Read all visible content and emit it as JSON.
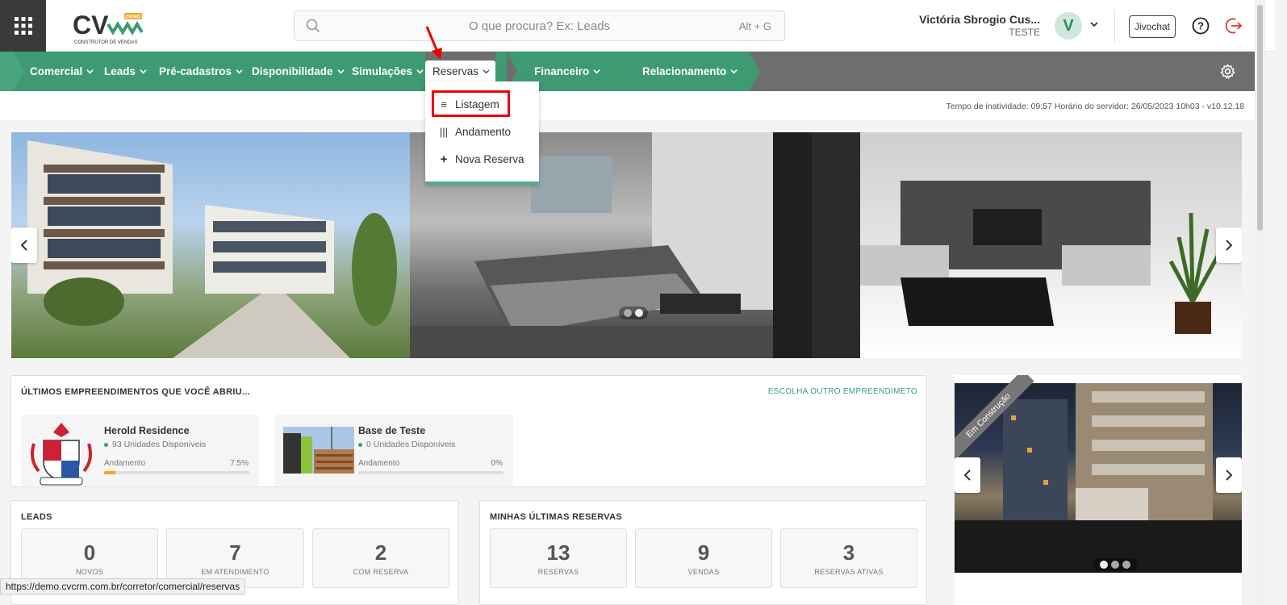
{
  "header": {
    "search": {
      "placeholder": "O que procura? Ex: Leads",
      "shortcut": "Alt + G"
    },
    "logo": {
      "text": "CV",
      "badge": "DEMO",
      "subtitle": "CONSTRUTOR DE VENDAS"
    },
    "user": {
      "name": "Victória Sbrogio Cus...",
      "role": "TESTE",
      "initial": "V"
    },
    "jivochat": "Jivochat"
  },
  "nav": {
    "items": [
      "Comercial",
      "Leads",
      "Pré-cadastros",
      "Disponibilidade",
      "Simulações",
      "Reservas",
      "Financeiro",
      "Relacionamento"
    ],
    "active": "Reservas",
    "colors": {
      "green": "#3e9a73",
      "gray": "#6e6e6e"
    }
  },
  "dropdown": {
    "items": [
      {
        "label": "Listagem",
        "icon": "list-icon"
      },
      {
        "label": "Andamento",
        "icon": "columns-icon"
      },
      {
        "label": "Nova Reserva",
        "icon": "plus-icon"
      }
    ],
    "highlighted": "Listagem"
  },
  "info": {
    "text": "Tempo de inatividade: 09:57   Horário do servidor: 26/05/2023 10h03 - v10.12.18"
  },
  "recent": {
    "title": "ÚLTIMOS EMPREENDIMENTOS QUE VOCÊ ABRIU...",
    "link": "ESCOLHA OUTRO EMPREENDIMETO",
    "items": [
      {
        "name": "Herold Residence",
        "units": "93 Unidades Disponíveis",
        "progress_label": "Andamento",
        "progress": "7.5%",
        "progress_value": 0.075
      },
      {
        "name": "Base de Teste",
        "units": "0 Unidades Disponíveis",
        "progress_label": "Andamento",
        "progress": "0%",
        "progress_value": 0
      }
    ]
  },
  "leads": {
    "title": "LEADS",
    "stats": [
      {
        "value": "0",
        "label": "NOVOS"
      },
      {
        "value": "7",
        "label": "EM ATENDIMENTO"
      },
      {
        "value": "2",
        "label": "COM RESERVA"
      }
    ]
  },
  "reservas": {
    "title": "MINHAS ÚLTIMAS RESERVAS",
    "stats": [
      {
        "value": "13",
        "label": "RESERVAS"
      },
      {
        "value": "9",
        "label": "VENDAS"
      },
      {
        "value": "3",
        "label": "RESERVAS ATIVAS"
      }
    ]
  },
  "side": {
    "ribbon": "Em Construção"
  },
  "statusbar": "https://demo.cvcrm.com.br/corretor/comercial/reservas"
}
